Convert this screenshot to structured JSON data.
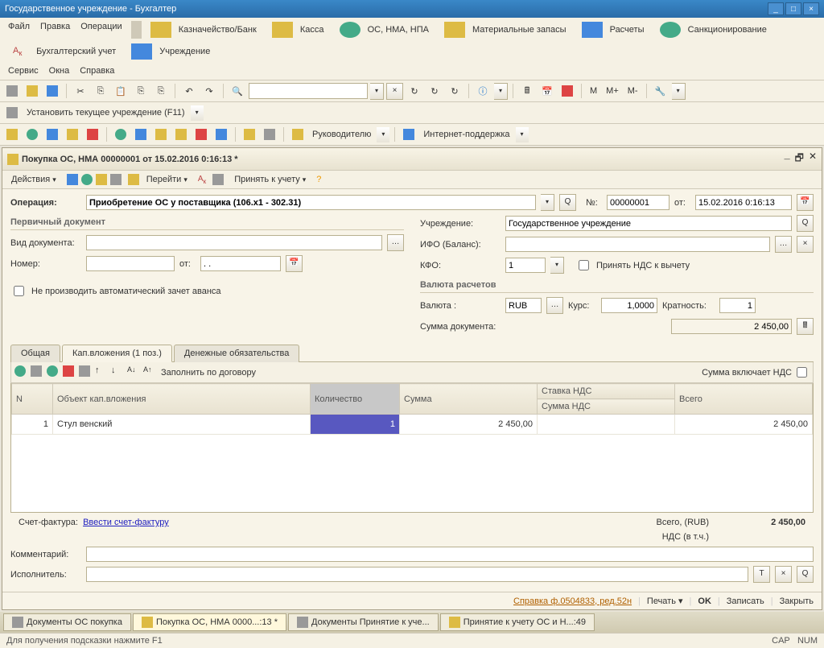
{
  "titlebar": {
    "text": "Государственное учреждение - Бухгалтер"
  },
  "menu": {
    "items": [
      "Файл",
      "Правка",
      "Операции",
      "Казначейство/Банк",
      "Касса",
      "ОС, НМА, НПА",
      "Материальные запасы",
      "Расчеты",
      "Санкционирование",
      "Бухгалтерский учет",
      "Учреждение",
      "Сервис",
      "Окна",
      "Справка"
    ]
  },
  "toolbar2": {
    "set_inst": "Установить текущее учреждение (F11)"
  },
  "toolbar3": {
    "manager": "Руководителю",
    "support": "Интернет-поддержка"
  },
  "doc": {
    "title": "Покупка ОС, НМА 00000001 от 15.02.2016 0:16:13 *",
    "actions": "Действия",
    "goto": "Перейти",
    "accept": "Принять к учету",
    "operation_lbl": "Операция:",
    "operation": "Приобретение ОС у поставщика (106.x1 - 302.31)",
    "num_lbl": "№:",
    "num": "00000001",
    "date_lbl": "от:",
    "date": "15.02.2016 0:16:13",
    "primary_h": "Первичный документ",
    "vid_lbl": "Вид документа:",
    "vid": "",
    "nomer_lbl": "Номер:",
    "nomer": "",
    "ot_lbl": "от:",
    "ot": ". .",
    "no_advance": "Не производить автоматический зачет аванса",
    "inst_lbl": "Учреждение:",
    "inst": "Государственное учреждение",
    "ifo_lbl": "ИФО (Баланс):",
    "ifo": "",
    "kfo_lbl": "КФО:",
    "kfo": "1",
    "nds_chk": "Принять НДС к вычету",
    "currency_h": "Валюта расчетов",
    "val_lbl": "Валюта :",
    "val": "RUB",
    "kurs_lbl": "Курс:",
    "kurs": "1,0000",
    "krat_lbl": "Кратность:",
    "krat": "1",
    "sum_lbl": "Сумма документа:",
    "sum": "2 450,00",
    "tabs": [
      "Общая",
      "Кап.вложения (1 поз.)",
      "Денежные обязательства"
    ],
    "fill": "Заполнить по договору",
    "sum_incl": "Сумма включает НДС",
    "grid": {
      "cols": [
        "N",
        "Объект кап.вложения",
        "Количество",
        "Сумма",
        "Ставка НДС",
        "Всего"
      ],
      "cols2": [
        "",
        "",
        "",
        "",
        "Сумма НДС",
        ""
      ],
      "rows": [
        {
          "n": "1",
          "obj": "Стул венский",
          "qty": "1",
          "sum": "2 450,00",
          "nds": "",
          "total": "2 450,00"
        }
      ]
    },
    "sf_lbl": "Счет-фактура:",
    "sf_link": "Ввести счет-фактуру",
    "total_lbl": "Всего, (RUB)",
    "total": "2 450,00",
    "nds_lbl": "НДС (в т.ч.)",
    "nds_val": "",
    "comment_lbl": "Комментарий:",
    "comment": "",
    "exec_lbl": "Исполнитель:",
    "exec": "",
    "help": "Справка ф.0504833, ред.52н",
    "print": "Печать",
    "ok": "OK",
    "save": "Записать",
    "close": "Закрыть"
  },
  "tabbar": {
    "items": [
      "Документы ОС покупка",
      "Покупка ОС, НМА 0000...:13 *",
      "Документы Принятие к уче...",
      "Принятие к учету ОС и Н...:49"
    ]
  },
  "status": {
    "hint": "Для получения подсказки нажмите F1",
    "cap": "CAP",
    "num": "NUM"
  }
}
